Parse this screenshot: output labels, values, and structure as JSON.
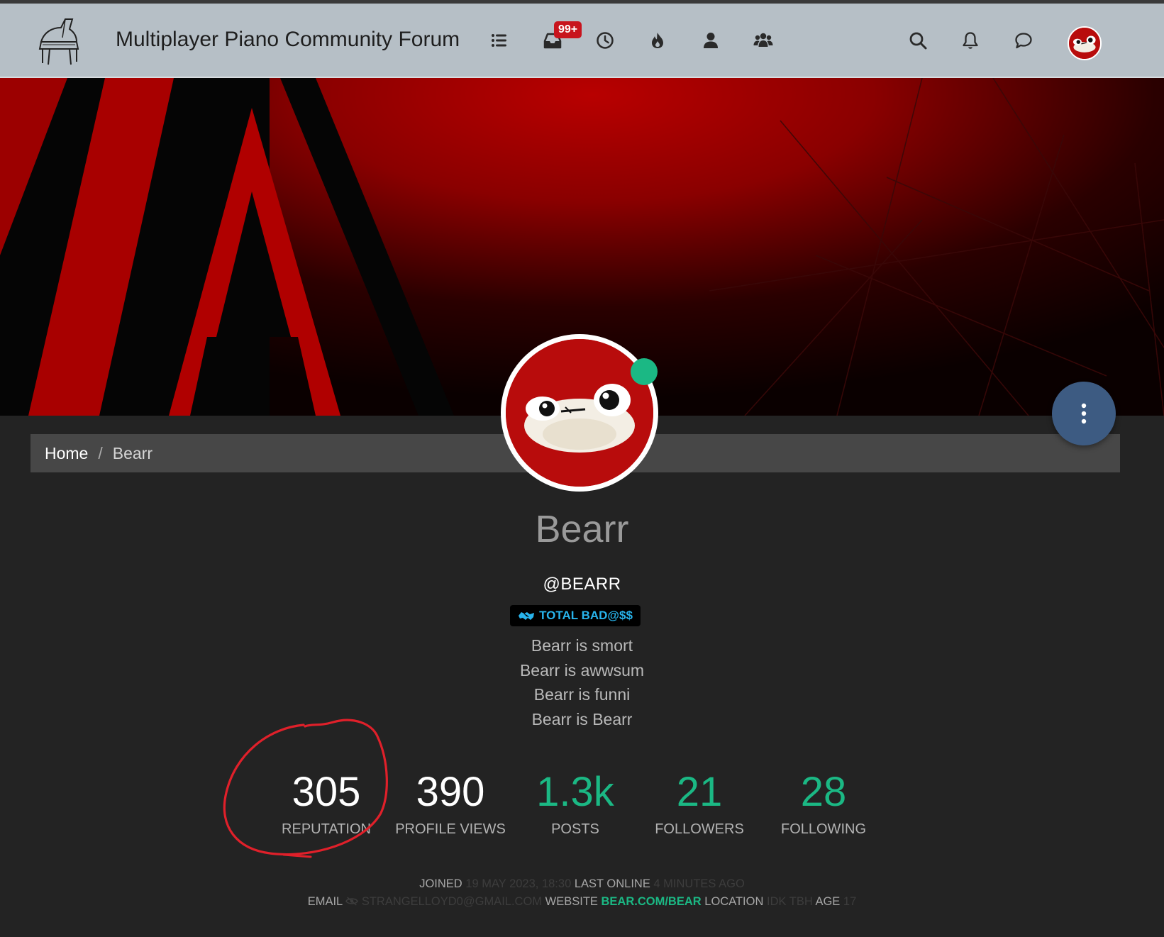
{
  "header": {
    "title": "Multiplayer Piano Community Forum",
    "unread_badge": "99+",
    "icons": [
      "categories-icon",
      "unread-icon",
      "recent-icon",
      "popular-icon",
      "users-icon",
      "groups-icon",
      "search-icon",
      "notifications-icon",
      "chats-icon"
    ]
  },
  "breadcrumb": {
    "home": "Home",
    "separator": "/",
    "current": "Bearr"
  },
  "profile": {
    "display_name": "Bearr",
    "username": "@BEARR",
    "group_badge": "TOTAL BAD@$$",
    "status": "online",
    "about": [
      "Bearr is smort",
      "Bearr is awwsum",
      "Bearr is funni",
      "Bearr is Bearr"
    ]
  },
  "stats": [
    {
      "value": "305",
      "label": "REPUTATION"
    },
    {
      "value": "390",
      "label": "PROFILE VIEWS"
    },
    {
      "value": "1.3k",
      "label": "POSTS"
    },
    {
      "value": "21",
      "label": "FOLLOWERS"
    },
    {
      "value": "28",
      "label": "FOLLOWING"
    }
  ],
  "meta": {
    "joined_label": "JOINED",
    "joined_value": "19 MAY 2023, 18:30",
    "last_online_label": "LAST ONLINE",
    "last_online_value": "4 MINUTES AGO",
    "email_label": "EMAIL",
    "email_value": "STRANGELLOYD0@GMAIL.COM",
    "website_label": "WEBSITE",
    "website_value": "BEAR.COM/BEAR",
    "location_label": "LOCATION",
    "location_value": "IDK TBH",
    "age_label": "AGE",
    "age_value": "17"
  },
  "colors": {
    "navbar": "#b6bfc6",
    "page_bg": "#232323",
    "accent_green": "#1bb884",
    "badge_red": "#c8141d",
    "fab_blue": "#3d5b82",
    "group_badge_text": "#28b4ec",
    "annotation_red": "#e0202a"
  }
}
